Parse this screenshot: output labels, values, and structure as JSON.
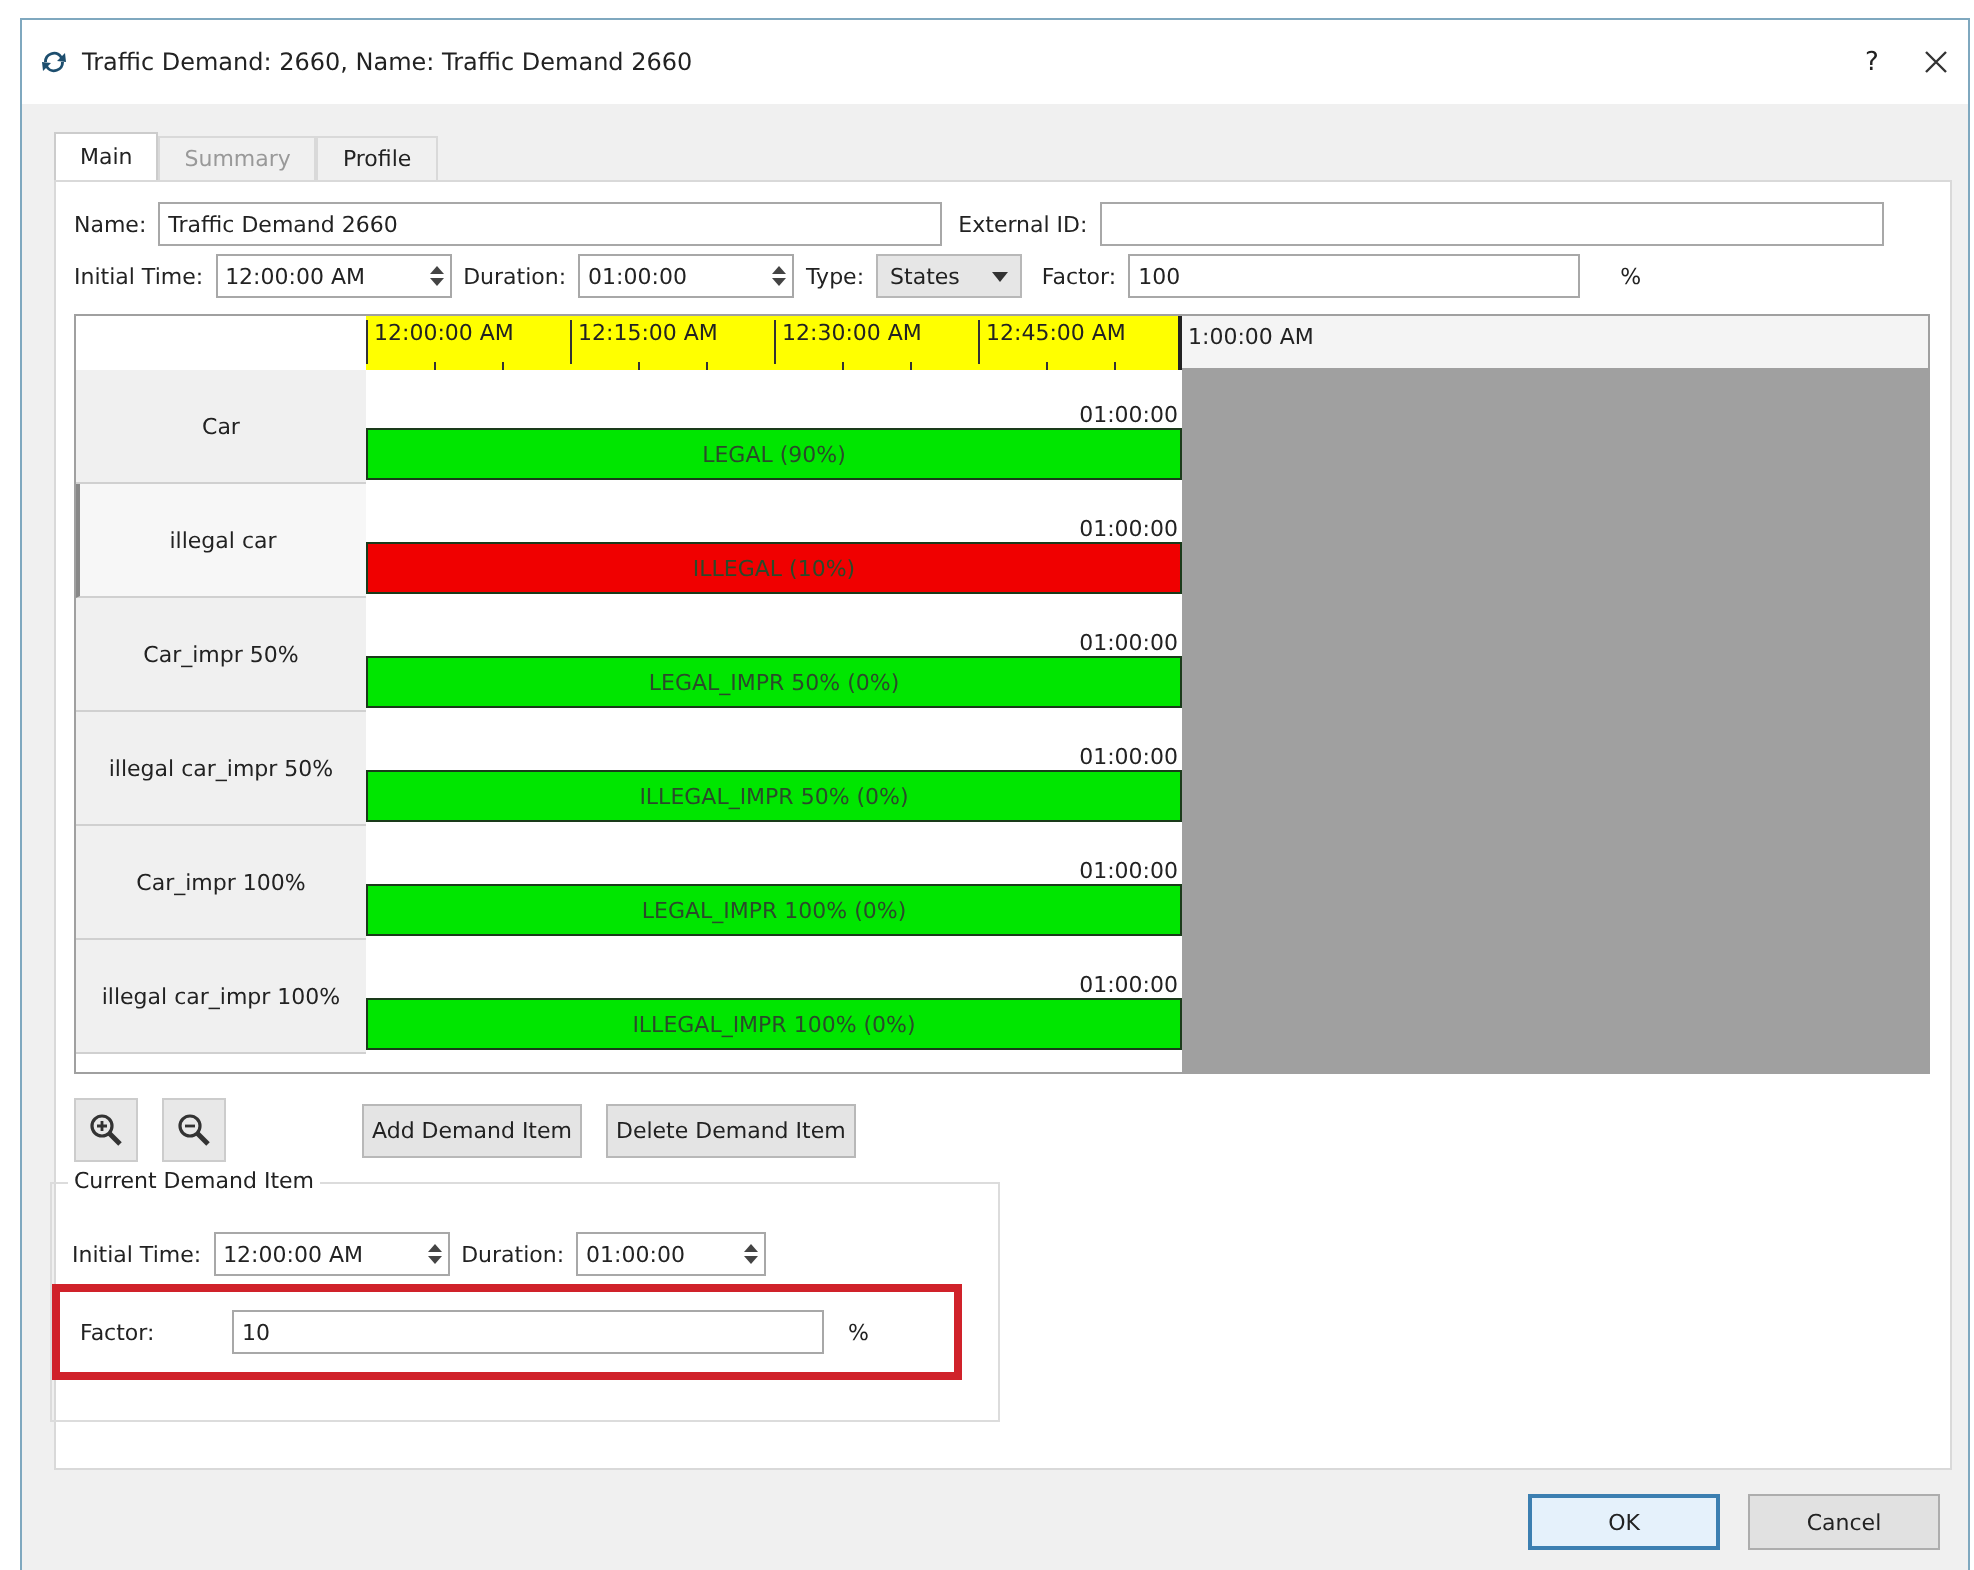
{
  "window": {
    "title": "Traffic Demand: 2660, Name: Traffic Demand 2660",
    "help": "?"
  },
  "tabs": [
    {
      "label": "Main",
      "selected": true,
      "disabled": false
    },
    {
      "label": "Summary",
      "selected": false,
      "disabled": true
    },
    {
      "label": "Profile",
      "selected": false,
      "disabled": false
    }
  ],
  "name": {
    "label": "Name:",
    "value": "Traffic Demand 2660"
  },
  "external_id": {
    "label": "External ID:"
  },
  "initial_time": {
    "label": "Initial Time:",
    "value": "12:00:00 AM"
  },
  "duration": {
    "label": "Duration:",
    "value": "01:00:00"
  },
  "type": {
    "label": "Type:",
    "value": "States"
  },
  "factor": {
    "label": "Factor:",
    "value": "100",
    "unit": "%"
  },
  "timeline": {
    "ticks": [
      "12:00:00 AM",
      "12:15:00 AM",
      "12:30:00 AM",
      "12:45:00 AM"
    ],
    "end": "1:00:00 AM"
  },
  "rows": [
    {
      "label": "Car",
      "selected": false,
      "duration": "01:00:00",
      "bar": "LEGAL (90%)",
      "color": "#00e600"
    },
    {
      "label": "illegal car",
      "selected": true,
      "duration": "01:00:00",
      "bar": "ILLEGAL (10%)",
      "color": "#f00000"
    },
    {
      "label": "Car_impr 50%",
      "selected": false,
      "duration": "01:00:00",
      "bar": "LEGAL_IMPR 50% (0%)",
      "color": "#00e600"
    },
    {
      "label": "illegal car_impr 50%",
      "selected": false,
      "duration": "01:00:00",
      "bar": "ILLEGAL_IMPR 50% (0%)",
      "color": "#00e600"
    },
    {
      "label": "Car_impr 100%",
      "selected": false,
      "duration": "01:00:00",
      "bar": "LEGAL_IMPR 100% (0%)",
      "color": "#00e600"
    },
    {
      "label": "illegal car_impr 100%",
      "selected": false,
      "duration": "01:00:00",
      "bar": "ILLEGAL_IMPR 100% (0%)",
      "color": "#00e600"
    }
  ],
  "actions": [
    "Add Demand Item",
    "Delete Demand Item"
  ],
  "current_item": {
    "title": "Current Demand Item",
    "initial_time": {
      "label": "Initial Time:",
      "value": "12:00:00 AM"
    },
    "duration": {
      "label": "Duration:",
      "value": "01:00:00"
    },
    "factor": {
      "label": "Factor:",
      "value": "10",
      "unit": "%"
    }
  },
  "buttons": [
    {
      "label": "OK",
      "default": true
    },
    {
      "label": "Cancel",
      "default": false
    }
  ]
}
